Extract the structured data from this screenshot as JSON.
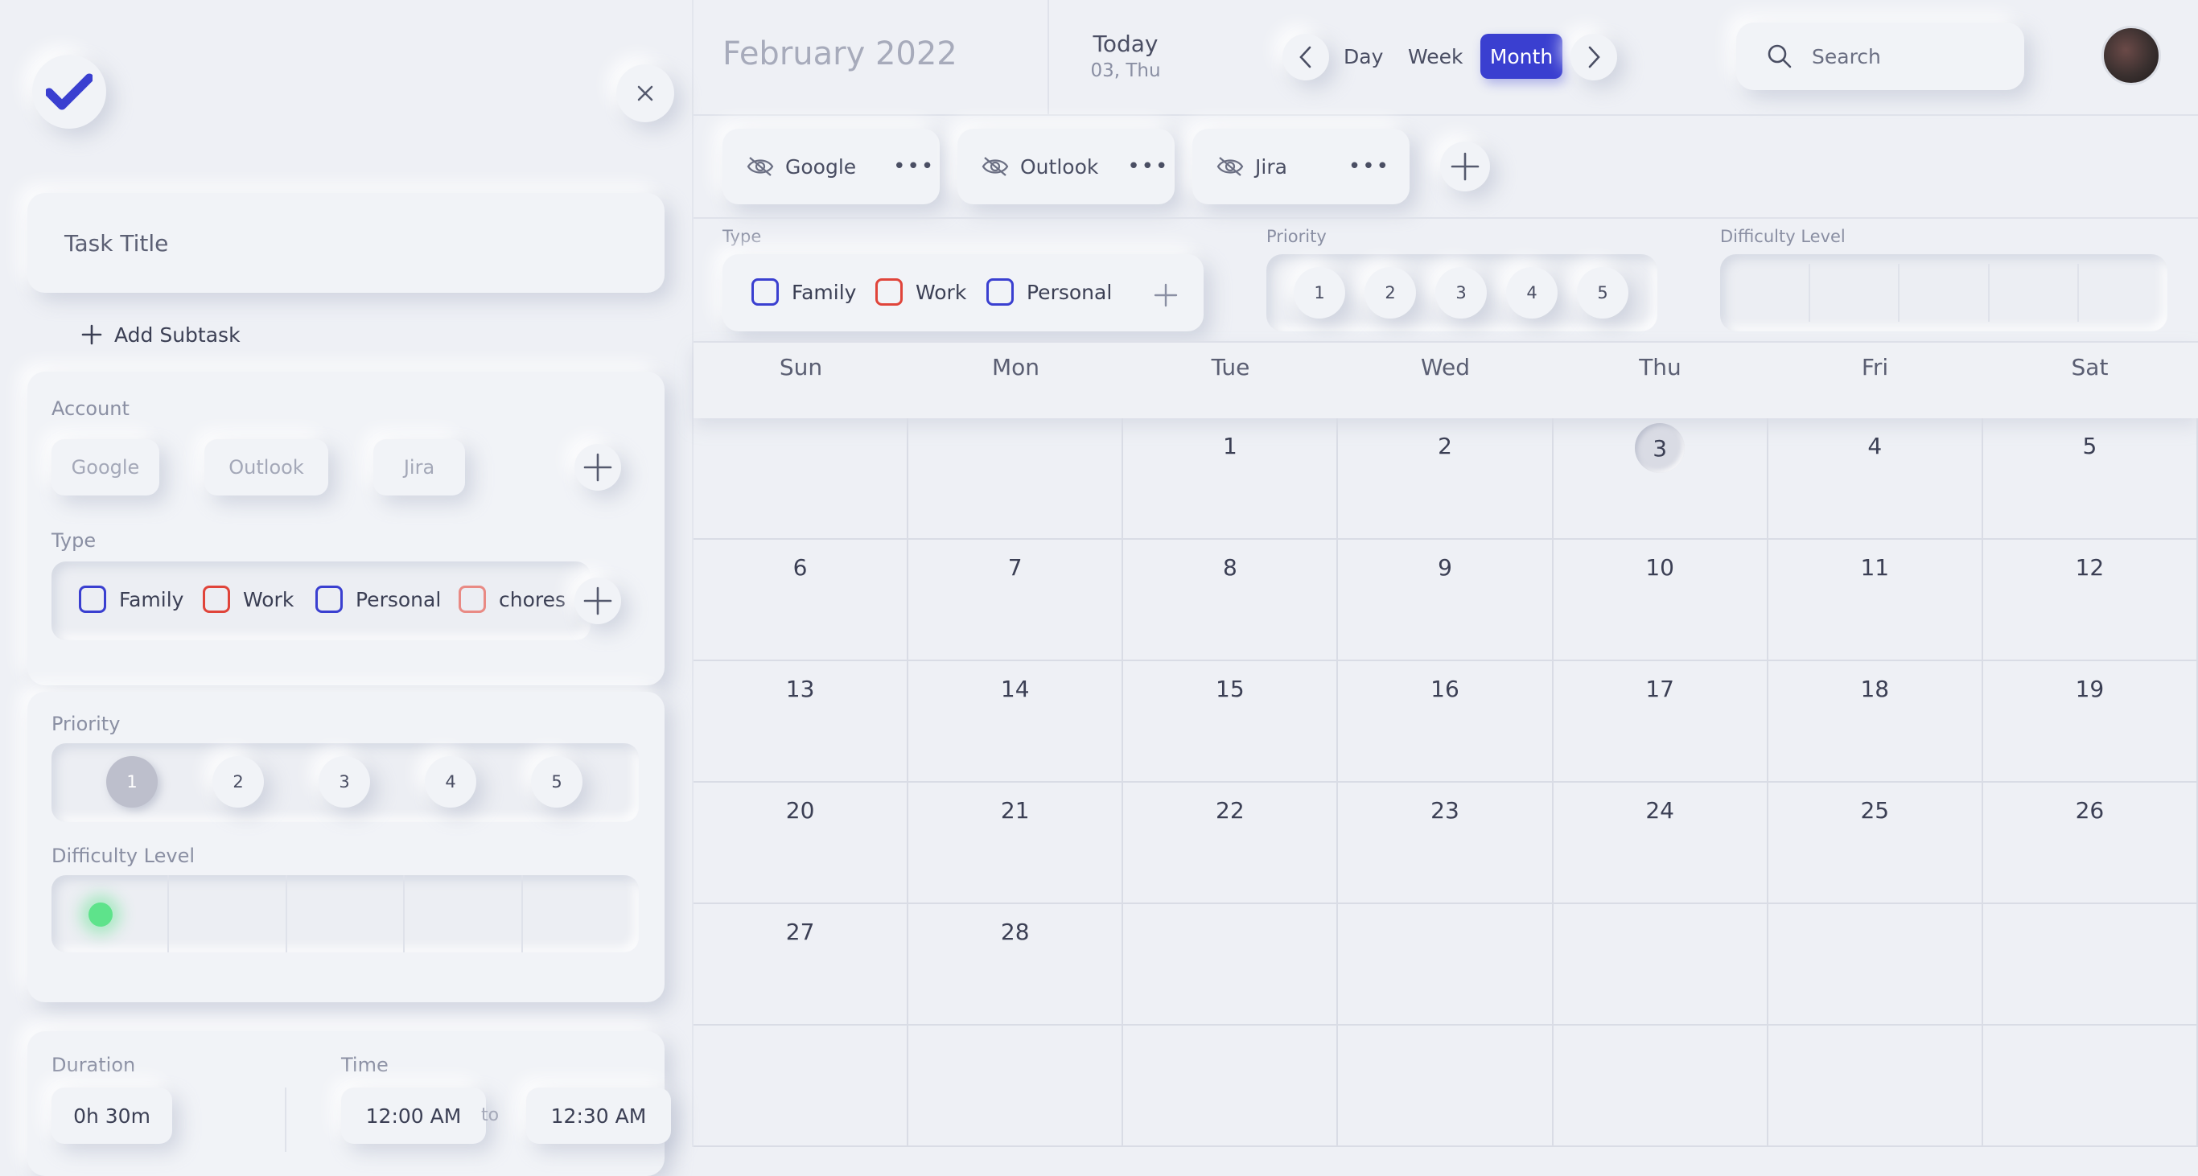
{
  "task_panel": {
    "title_placeholder": "Task Title",
    "add_subtask": "Add Subtask",
    "account": {
      "label": "Account",
      "options": [
        "Google",
        "Outlook",
        "Jira"
      ]
    },
    "type": {
      "label": "Type",
      "options": [
        {
          "label": "Family",
          "color": "#3a3fd0"
        },
        {
          "label": "Work",
          "color": "#e0443a"
        },
        {
          "label": "Personal",
          "color": "#3a3fd0"
        },
        {
          "label": "chores",
          "color": "#e98a84"
        }
      ]
    },
    "priority": {
      "label": "Priority",
      "levels": [
        "1",
        "2",
        "3",
        "4",
        "5"
      ],
      "selected": "1"
    },
    "difficulty": {
      "label": "Difficulty Level",
      "indicator_color": "#5ee38b"
    },
    "duration": {
      "label": "Duration",
      "value": "0h 30m"
    },
    "time": {
      "label": "Time",
      "start": "12:00 AM",
      "separator": "to",
      "end": "12:30 AM"
    }
  },
  "header": {
    "month_title": "February 2022",
    "today_label": "Today",
    "today_date": "03, Thu",
    "views": [
      "Day",
      "Week",
      "Month"
    ],
    "active_view": "Month",
    "search_placeholder": "Search",
    "accent": "#3a3fd0"
  },
  "calendars": [
    "Google",
    "Outlook",
    "Jira"
  ],
  "filters": {
    "type_label": "Type",
    "types": [
      {
        "label": "Family",
        "color": "#3a3fd0"
      },
      {
        "label": "Work",
        "color": "#e0443a"
      },
      {
        "label": "Personal",
        "color": "#3a3fd0"
      }
    ],
    "priority_label": "Priority",
    "priorities": [
      "1",
      "2",
      "3",
      "4",
      "5"
    ],
    "difficulty_label": "Difficulty Level"
  },
  "calendar": {
    "weekdays": [
      "Sun",
      "Mon",
      "Tue",
      "Wed",
      "Thu",
      "Fri",
      "Sat"
    ],
    "weeks": [
      [
        "",
        "",
        "1",
        "2",
        "3",
        "4",
        "5"
      ],
      [
        "6",
        "7",
        "8",
        "9",
        "10",
        "11",
        "12"
      ],
      [
        "13",
        "14",
        "15",
        "16",
        "17",
        "18",
        "19"
      ],
      [
        "20",
        "21",
        "22",
        "23",
        "24",
        "25",
        "26"
      ],
      [
        "27",
        "28",
        "",
        "",
        "",
        "",
        ""
      ],
      [
        "",
        "",
        "",
        "",
        "",
        "",
        ""
      ]
    ],
    "today": "3"
  }
}
